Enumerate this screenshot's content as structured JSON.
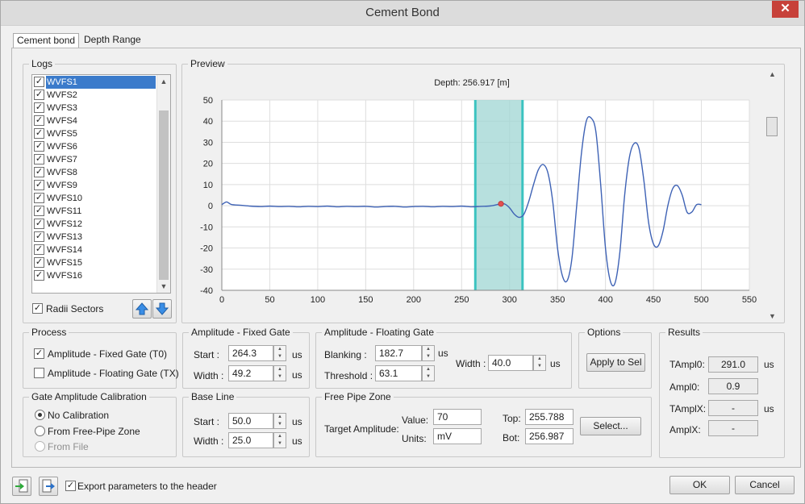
{
  "window": {
    "title": "Cement Bond",
    "close_glyph": "✕"
  },
  "tabs": [
    {
      "label": "Cement bond",
      "active": true
    },
    {
      "label": "Depth Range",
      "active": false
    }
  ],
  "logs": {
    "title": "Logs",
    "items": [
      "WVFS1",
      "WVFS2",
      "WVFS3",
      "WVFS4",
      "WVFS5",
      "WVFS6",
      "WVFS7",
      "WVFS8",
      "WVFS9",
      "WVFS10",
      "WVFS11",
      "WVFS12",
      "WVFS13",
      "WVFS14",
      "WVFS15",
      "WVFS16"
    ],
    "selected_index": 0,
    "radii_sectors_label": "Radii Sectors",
    "radii_sectors_checked": true
  },
  "preview": {
    "title": "Preview",
    "depth_label": "Depth: 256.917 [m]",
    "chart_data": {
      "type": "line",
      "x": [
        0,
        5,
        10,
        20,
        30,
        40,
        50,
        60,
        70,
        80,
        90,
        100,
        110,
        120,
        130,
        140,
        150,
        160,
        170,
        180,
        190,
        200,
        210,
        220,
        230,
        240,
        250,
        260,
        270,
        280,
        290,
        295,
        300,
        305,
        310,
        315,
        320,
        325,
        330,
        335,
        340,
        345,
        350,
        355,
        360,
        365,
        370,
        375,
        380,
        385,
        390,
        395,
        400,
        405,
        410,
        415,
        420,
        425,
        430,
        435,
        440,
        445,
        450,
        455,
        460,
        465,
        470,
        475,
        480,
        485,
        490,
        495,
        500
      ],
      "y": [
        0.5,
        1.8,
        0.6,
        0.2,
        -0.2,
        -0.4,
        -0.2,
        -0.4,
        -0.3,
        -0.5,
        -0.3,
        -0.4,
        -0.2,
        -0.5,
        -0.3,
        -0.4,
        -0.3,
        -0.6,
        -0.4,
        -0.3,
        -0.6,
        -0.4,
        -0.3,
        -0.5,
        -0.3,
        -0.4,
        -0.2,
        -0.5,
        -0.3,
        -0.1,
        0.8,
        0.8,
        -1.0,
        -4.0,
        -5.5,
        -4.0,
        2.0,
        10.0,
        17.0,
        19.5,
        15.5,
        2.0,
        -20.0,
        -33.0,
        -35.5,
        -25.0,
        0.0,
        25.0,
        40.0,
        41.5,
        35.0,
        10.0,
        -20.0,
        -35.5,
        -36.5,
        -22.0,
        5.0,
        23.0,
        29.5,
        27.0,
        12.0,
        -8.0,
        -18.0,
        -19.0,
        -12.0,
        0.0,
        8.0,
        9.5,
        5.0,
        -3.0,
        -3.0,
        0.5,
        0.5
      ],
      "xlim": [
        0,
        550
      ],
      "ylim": [
        -40,
        50
      ],
      "x_ticks": [
        0,
        50,
        100,
        150,
        200,
        250,
        300,
        350,
        400,
        450,
        500,
        550
      ],
      "y_ticks": [
        50,
        40,
        30,
        20,
        10,
        0,
        -10,
        -20,
        -30,
        -40
      ],
      "gate_start": 264.3,
      "gate_end": 313.5,
      "marker": {
        "x": 291.0,
        "y": 0.9
      },
      "grid": true,
      "colors": {
        "line": "#3e62b5",
        "gate_fill": "#9fd5d3",
        "gate_edge": "#3cc3c0",
        "marker": "#e25050"
      }
    }
  },
  "process": {
    "title": "Process",
    "options": [
      {
        "label": "Amplitude - Fixed Gate (T0)",
        "checked": true
      },
      {
        "label": "Amplitude - Floating Gate (TX)",
        "checked": false
      }
    ]
  },
  "fixed_gate": {
    "title": "Amplitude - Fixed Gate",
    "start_label": "Start :",
    "start_value": "264.3",
    "width_label": "Width :",
    "width_value": "49.2",
    "unit": "us"
  },
  "floating_gate": {
    "title": "Amplitude - Floating Gate",
    "blanking_label": "Blanking :",
    "blanking_value": "182.7",
    "threshold_label": "Threshold :",
    "threshold_value": "63.1",
    "width_label": "Width :",
    "width_value": "40.0",
    "unit": "us"
  },
  "options": {
    "title": "Options",
    "apply_label": "Apply to Sel"
  },
  "results": {
    "title": "Results",
    "rows": [
      {
        "label": "TAmpl0:",
        "value": "291.0",
        "unit": "us"
      },
      {
        "label": "Ampl0:",
        "value": "0.9",
        "unit": ""
      },
      {
        "label": "TAmplX:",
        "value": "-",
        "unit": "us"
      },
      {
        "label": "AmplX:",
        "value": "-",
        "unit": ""
      }
    ]
  },
  "calibration": {
    "title": "Gate Amplitude Calibration",
    "options": [
      {
        "label": "No Calibration",
        "selected": true
      },
      {
        "label": "From Free-Pipe Zone",
        "selected": false
      },
      {
        "label": "From File",
        "selected": false,
        "disabled": true
      }
    ]
  },
  "baseline": {
    "title": "Base Line",
    "start_label": "Start :",
    "start_value": "50.0",
    "width_label": "Width :",
    "width_value": "25.0",
    "unit": "us"
  },
  "free_pipe": {
    "title": "Free Pipe Zone",
    "target_label": "Target Amplitude:",
    "value_label": "Value:",
    "value": "70",
    "units_label": "Units:",
    "units": "mV",
    "top_label": "Top:",
    "top": "255.788",
    "bot_label": "Bot:",
    "bot": "256.987",
    "select_label": "Select..."
  },
  "footer": {
    "export_label": "Export parameters to the header",
    "export_checked": true,
    "ok_label": "OK",
    "cancel_label": "Cancel",
    "icons": [
      "import-icon",
      "export-icon"
    ]
  }
}
